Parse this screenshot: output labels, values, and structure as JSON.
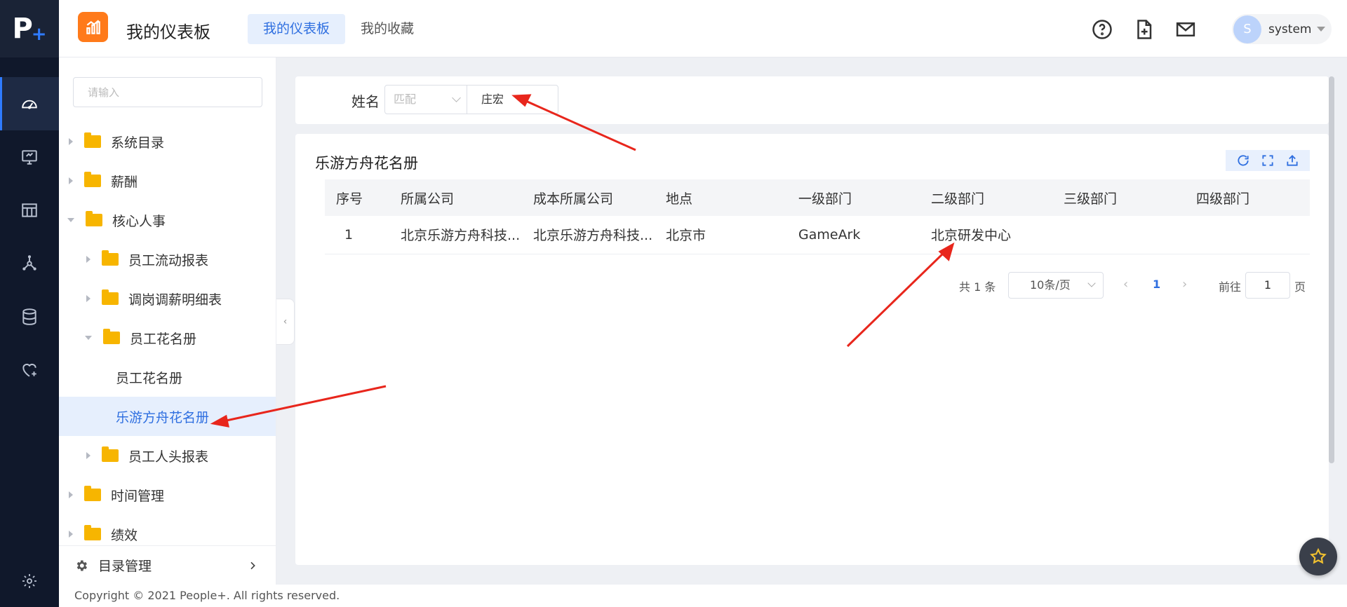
{
  "brand": {
    "logo_letter": "P",
    "logo_plus": "+"
  },
  "header": {
    "app_title": "我的仪表板",
    "tabs": [
      {
        "label": "我的仪表板",
        "active": true
      },
      {
        "label": "我的收藏",
        "active": false
      }
    ],
    "icons": [
      "help-icon",
      "new-file-icon",
      "mail-icon"
    ],
    "user": {
      "avatar_letter": "S",
      "name": "system"
    }
  },
  "rail": {
    "items": [
      "dashboard-icon",
      "monitor-icon",
      "table-icon",
      "network-icon",
      "database-icon",
      "heart-plus-icon"
    ],
    "settings_icon": "gear-icon"
  },
  "sidebar": {
    "search_placeholder": "请输入",
    "nodes": [
      {
        "label": "系统目录",
        "level": 0,
        "type": "folder",
        "state": "collapsed"
      },
      {
        "label": "薪酬",
        "level": 0,
        "type": "folder",
        "state": "collapsed"
      },
      {
        "label": "核心人事",
        "level": 0,
        "type": "folder",
        "state": "expanded"
      },
      {
        "label": "员工流动报表",
        "level": 1,
        "type": "folder",
        "state": "collapsed"
      },
      {
        "label": "调岗调薪明细表",
        "level": 1,
        "type": "folder",
        "state": "collapsed"
      },
      {
        "label": "员工花名册",
        "level": 1,
        "type": "folder",
        "state": "expanded"
      },
      {
        "label": "员工花名册",
        "level": 2,
        "type": "leaf"
      },
      {
        "label": "乐游方舟花名册",
        "level": 2,
        "type": "leaf",
        "selected": true
      },
      {
        "label": "员工人头报表",
        "level": 1,
        "type": "folder",
        "state": "collapsed"
      },
      {
        "label": "时间管理",
        "level": 0,
        "type": "folder",
        "state": "collapsed"
      },
      {
        "label": "绩效",
        "level": 0,
        "type": "folder",
        "state": "collapsed"
      }
    ],
    "bottom_label": "目录管理",
    "collapse_glyph": "‹"
  },
  "filter": {
    "field_label": "姓名",
    "operator_placeholder": "匹配",
    "value": "庄宏"
  },
  "report": {
    "title": "乐游方舟花名册",
    "toolbar_icons": [
      "refresh-icon",
      "fullscreen-icon",
      "export-icon"
    ],
    "columns": [
      "序号",
      "所属公司",
      "成本所属公司",
      "地点",
      "一级部门",
      "二级部门",
      "三级部门",
      "四级部门"
    ],
    "rows": [
      [
        "1",
        "北京乐游方舟科技...",
        "北京乐游方舟科技...",
        "北京市",
        "GameArk",
        "北京研发中心",
        "",
        ""
      ]
    ],
    "pagination": {
      "total": "共 1 条",
      "page_size": "10条/页",
      "current_page": "1",
      "goto_label": "前往",
      "goto_value": "1",
      "page_suffix": "页"
    }
  },
  "footer": {
    "copyright": "Copyright © 2021 People+. All rights reserved."
  },
  "colors": {
    "accent": "#2f6fe0",
    "rail_bg": "#10182b",
    "folder": "#f7b500",
    "annotation_arrow": "#e8261c"
  }
}
